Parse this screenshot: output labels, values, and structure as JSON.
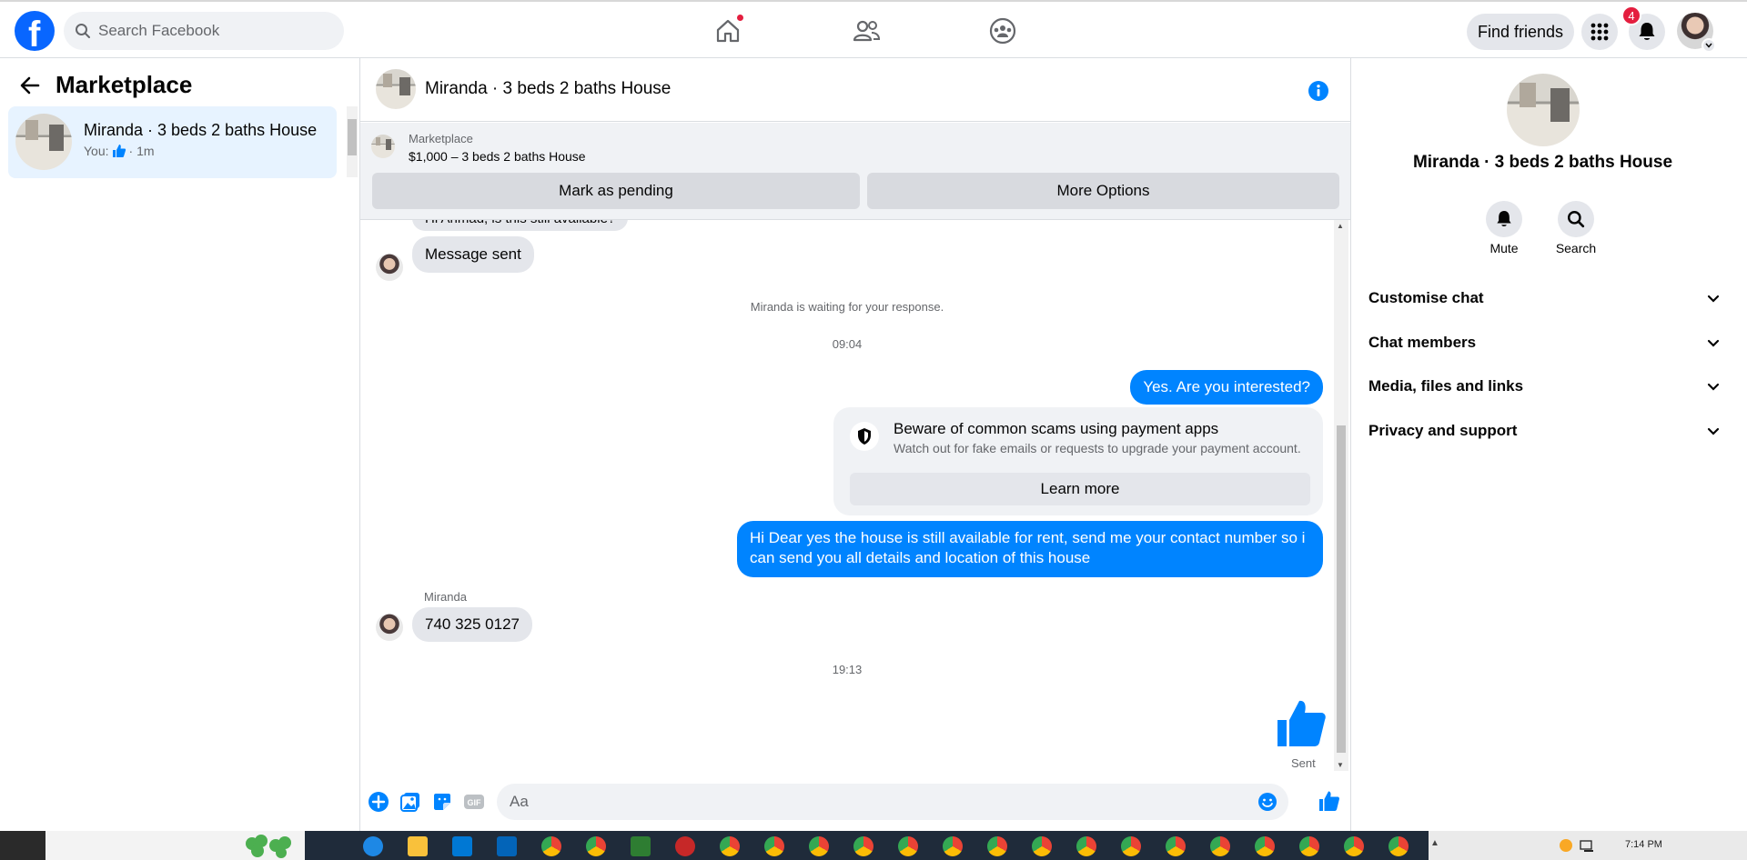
{
  "nav": {
    "search_placeholder": "Search Facebook",
    "find_friends": "Find friends",
    "notification_count": "4",
    "icons": [
      "home-icon",
      "friends-icon",
      "groups-icon",
      "menu-grid-icon",
      "bell-icon"
    ]
  },
  "sidebar": {
    "title": "Marketplace",
    "conversation": {
      "name": "Miranda · 3 beds 2 baths House",
      "sub_prefix": "You:",
      "sub_time": "· 1m"
    }
  },
  "chat": {
    "title": "Miranda · 3 beds 2 baths House",
    "listing": {
      "label": "Marketplace",
      "price_title": "$1,000 – 3 beds 2 baths House",
      "mark_pending": "Mark as pending",
      "more_options": "More Options"
    },
    "partial_message": "Hi Ahmad, is this still available?",
    "message_sent": "Message sent",
    "waiting_notice": "Miranda is waiting for your response.",
    "time_1": "09:04",
    "outgoing_1": "Yes. Are you interested?",
    "scam": {
      "title": "Beware of common scams using payment apps",
      "description": "Watch out for fake emails or requests to upgrade your payment account.",
      "button": "Learn more"
    },
    "outgoing_2": "Hi Dear yes the house is still available for rent, send me your contact number so i can send you all details and location of this house",
    "incoming_sender": "Miranda",
    "incoming_phone": "740 325 0127",
    "time_2": "19:13",
    "sent_status": "Sent"
  },
  "composer": {
    "placeholder": "Aa"
  },
  "details": {
    "title": "Miranda · 3 beds 2 baths House",
    "mute": "Mute",
    "search": "Search",
    "sections": [
      "Customise chat",
      "Chat members",
      "Media, files and links",
      "Privacy and support"
    ]
  },
  "taskbar": {
    "clock": "7:14 PM"
  },
  "colors": {
    "accent": "#0084ff",
    "brand": "#0866ff",
    "badge": "#e41e3f"
  }
}
